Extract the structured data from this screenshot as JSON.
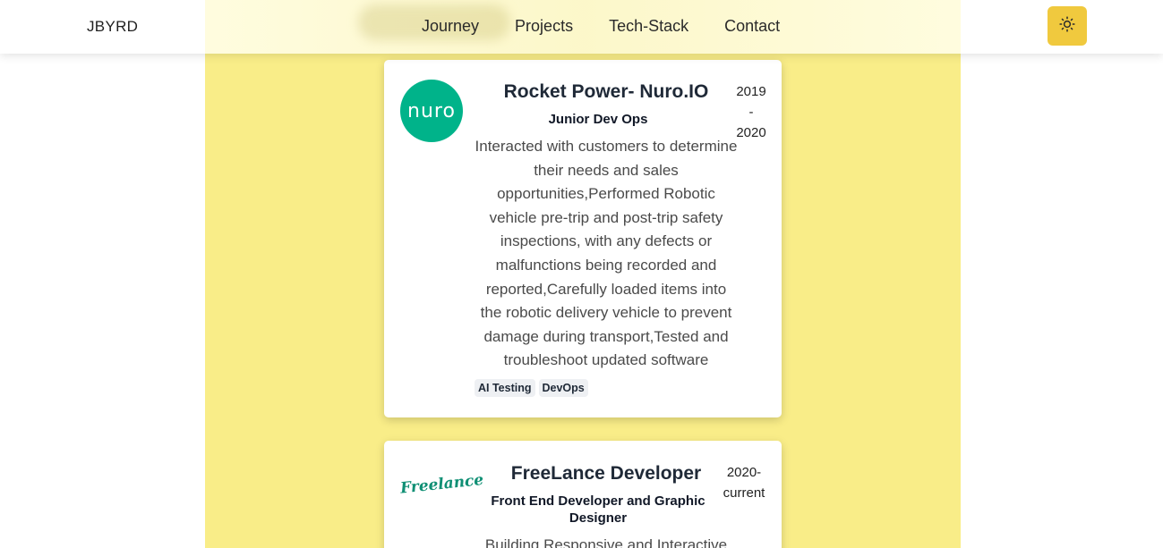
{
  "header": {
    "brand": "JBYRD",
    "nav": [
      "Journey",
      "Projects",
      "Tech-Stack",
      "Contact"
    ],
    "theme_toggle_icon": "sun-icon"
  },
  "colors": {
    "column_bg": "#f9ed88",
    "toggle_bg": "#f0c93e",
    "nuro_green": "#00b38a"
  },
  "experience": [
    {
      "logo_text": "nuro",
      "title": "Rocket Power- Nuro.IO",
      "role": "Junior Dev Ops",
      "dates": {
        "start": "2019",
        "separator": "-",
        "end": "2020"
      },
      "description_lines": [
        "Interacted with customers to determine",
        "their needs and sales",
        "opportunities,Performed Robotic",
        "vehicle pre-trip and post-trip safety",
        "inspections, with any defects or",
        "malfunctions being recorded and",
        "reported,Carefully loaded items into",
        "the robotic delivery vehicle to prevent",
        "damage during transport,Tested and",
        "troubleshoot updated software"
      ],
      "tags": [
        "AI Testing",
        "DevOps"
      ]
    },
    {
      "logo_text": "Freelance",
      "title": "FreeLance Developer",
      "role_lines": [
        "Front End Developer and Graphic",
        "Designer"
      ],
      "dates": {
        "start": "2020-",
        "end": "current"
      },
      "description_lines": [
        "Building Responsive and Interactive"
      ]
    }
  ]
}
